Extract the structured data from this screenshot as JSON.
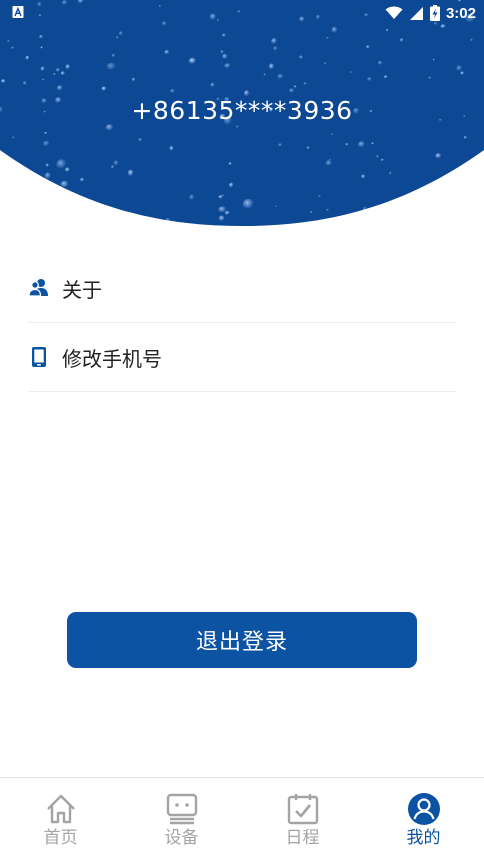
{
  "status_bar": {
    "time": "3:02"
  },
  "profile": {
    "phone": "+86135****3936"
  },
  "menu": [
    {
      "label": "关于",
      "icon": "users-icon"
    },
    {
      "label": "修改手机号",
      "icon": "phone-icon"
    }
  ],
  "logout_label": "退出登录",
  "nav": [
    {
      "label": "首页",
      "icon": "home-icon",
      "active": false
    },
    {
      "label": "设备",
      "icon": "device-icon",
      "active": false
    },
    {
      "label": "日程",
      "icon": "calendar-check-icon",
      "active": false
    },
    {
      "label": "我的",
      "icon": "profile-icon",
      "active": true
    }
  ],
  "colors": {
    "brand": "#0d53a4",
    "inactive": "#a4a4a4"
  }
}
